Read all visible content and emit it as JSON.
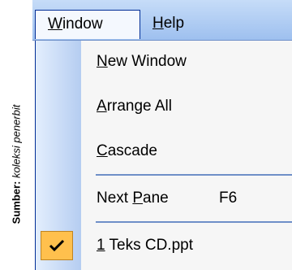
{
  "caption": {
    "label": "Sumber:",
    "text": "koleksi penerbit"
  },
  "menubar": {
    "window": {
      "underline": "W",
      "rest": "indow"
    },
    "help": {
      "underline": "H",
      "rest": "elp"
    }
  },
  "window_menu": {
    "new_window": {
      "underline": "N",
      "rest": "ew Window"
    },
    "arrange_all": {
      "underline": "A",
      "rest": "rrange All"
    },
    "cascade": {
      "underline": "C",
      "rest": "ascade"
    },
    "next_pane": {
      "before": "Next ",
      "underline": "P",
      "rest": "ane",
      "shortcut": "F6"
    },
    "recent_file": {
      "underline": "1",
      "rest": " Teks CD.ppt",
      "checked": true
    }
  },
  "colors": {
    "menubar": "#9ec0ef",
    "gutter": "#b5cdf1",
    "check_highlight": "#ffc04d",
    "separator": "#6f8fc8"
  }
}
